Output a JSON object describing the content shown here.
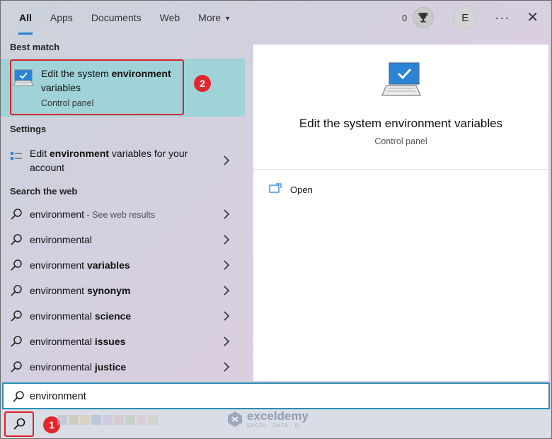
{
  "tabs": [
    {
      "label": "All",
      "active": true
    },
    {
      "label": "Apps"
    },
    {
      "label": "Documents"
    },
    {
      "label": "Web"
    },
    {
      "label": "More"
    }
  ],
  "header": {
    "rewards_count": "0",
    "avatar_initial": "E",
    "more_options": "···",
    "close": "✕"
  },
  "best_match": {
    "heading": "Best match",
    "title_plain": "Edit the system ",
    "title_bold": "environment",
    "title_rest": "variables",
    "subtitle": "Control panel",
    "step": "2"
  },
  "settings": {
    "heading": "Settings",
    "items": [
      {
        "pre": "Edit ",
        "bold": "environment",
        "post": " variables for your account"
      }
    ]
  },
  "web": {
    "heading": "Search the web",
    "items": [
      {
        "text": "environment",
        "bold": "",
        "dim": " - See web results"
      },
      {
        "text": "environmental",
        "bold": "",
        "dim": ""
      },
      {
        "text": "environment ",
        "bold": "variables",
        "dim": ""
      },
      {
        "text": "environment ",
        "bold": "synonym",
        "dim": ""
      },
      {
        "text": "environmental ",
        "bold": "science",
        "dim": ""
      },
      {
        "text": "environmental ",
        "bold": "issues",
        "dim": ""
      },
      {
        "text": "environmental ",
        "bold": "justice",
        "dim": ""
      }
    ]
  },
  "detail": {
    "title": "Edit the system environment variables",
    "subtitle": "Control panel",
    "action_open": "Open"
  },
  "search": {
    "value": "environment"
  },
  "taskbar": {
    "step": "1"
  },
  "watermark": {
    "name": "exceldemy",
    "tagline": "EXCEL · DATA · BI"
  },
  "colors": {
    "accent": "#2a7fd4",
    "highlight": "#9fd3d8",
    "callout_red": "#e0202a"
  }
}
